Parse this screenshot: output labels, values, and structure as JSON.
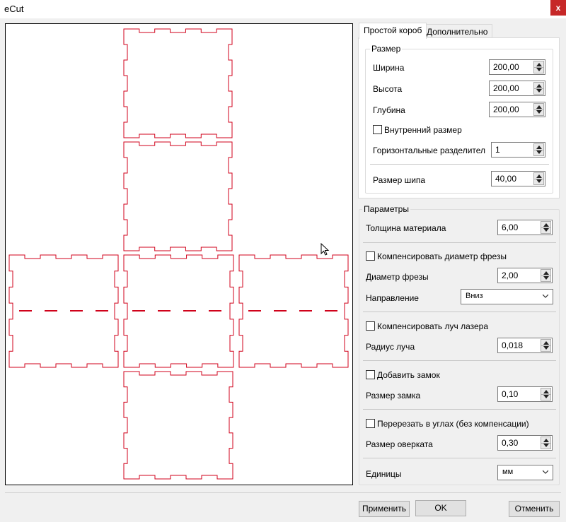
{
  "window": {
    "title": "eCut",
    "close_label": "x"
  },
  "tabs": [
    {
      "label": "Простой короб",
      "active": true
    },
    {
      "label": "Дополнительно",
      "active": false
    }
  ],
  "size_group": {
    "title": "Размер",
    "width_label": "Ширина",
    "width_value": "200,00",
    "height_label": "Высота",
    "height_value": "200,00",
    "depth_label": "Глубина",
    "depth_value": "200,00",
    "inner_size_label": "Внутренний размер",
    "inner_size_checked": false,
    "dividers_label": "Горизонтальные разделител",
    "dividers_value": "1",
    "tenon_label": "Размер шипа",
    "tenon_value": "40,00"
  },
  "params_group": {
    "title": "Параметры",
    "thickness_label": "Толщина материала",
    "thickness_value": "6,00",
    "compensate_cutter_label": "Компенсировать диаметр фрезы",
    "compensate_cutter_checked": false,
    "cutter_diameter_label": "Диаметр фрезы",
    "cutter_diameter_value": "2,00",
    "direction_label": "Направление",
    "direction_value": "Вниз",
    "compensate_laser_label": "Компенсировать луч лазера",
    "compensate_laser_checked": false,
    "beam_radius_label": "Радиус луча",
    "beam_radius_value": "0,018",
    "add_lock_label": "Добавить замок",
    "add_lock_checked": false,
    "lock_size_label": "Размер замка",
    "lock_size_value": "0,10",
    "overcut_corners_label": "Перерезать в углах (без компенсации)",
    "overcut_corners_checked": false,
    "overcut_size_label": "Размер оверката",
    "overcut_size_value": "0,30",
    "units_label": "Единицы",
    "units_value": "мм"
  },
  "buttons": {
    "apply": "Применить",
    "ok": "OK",
    "cancel": "Отменить"
  },
  "colors": {
    "outline": "#d0021b",
    "accent_close": "#c62828"
  }
}
